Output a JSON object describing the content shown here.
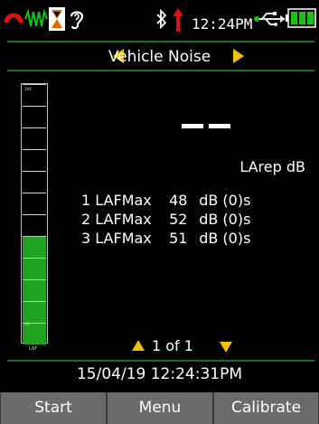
{
  "status_bar": {
    "time": "12:24PM",
    "icons": [
      "overload-indicator-icon",
      "waveform-icon",
      "hourglass-icon",
      "ear-icon",
      "bluetooth-icon",
      "record-arrow-icon",
      "usb-icon",
      "battery-icon"
    ]
  },
  "screen": {
    "title": "Vehicle Noise"
  },
  "meter": {
    "top_label": "140",
    "bottom_label": "20",
    "unit_label": "LAF",
    "segments_total": 12,
    "segments_lit": 5
  },
  "main_readout": {
    "value": "– –",
    "unit": "LArep dB"
  },
  "results": [
    {
      "label": "1 LAFMax",
      "value": "48",
      "unit": "dB",
      "suffix": "(0)s"
    },
    {
      "label": "2 LAFMax",
      "value": "52",
      "unit": "dB",
      "suffix": "(0)s"
    },
    {
      "label": "3 LAFMax",
      "value": "51",
      "unit": "dB",
      "suffix": "(0)s"
    }
  ],
  "pager": {
    "label": "1 of 1"
  },
  "datetime": "15/04/19 12:24:31PM",
  "softkeys": {
    "start": "Start",
    "menu": "Menu",
    "calibrate": "Calibrate"
  },
  "colors": {
    "accent": "#f2c200",
    "meter_on": "#21a321",
    "divider": "#1d6b2e",
    "softkey_bg": "#6b6b6b",
    "alert": "#e01010"
  }
}
